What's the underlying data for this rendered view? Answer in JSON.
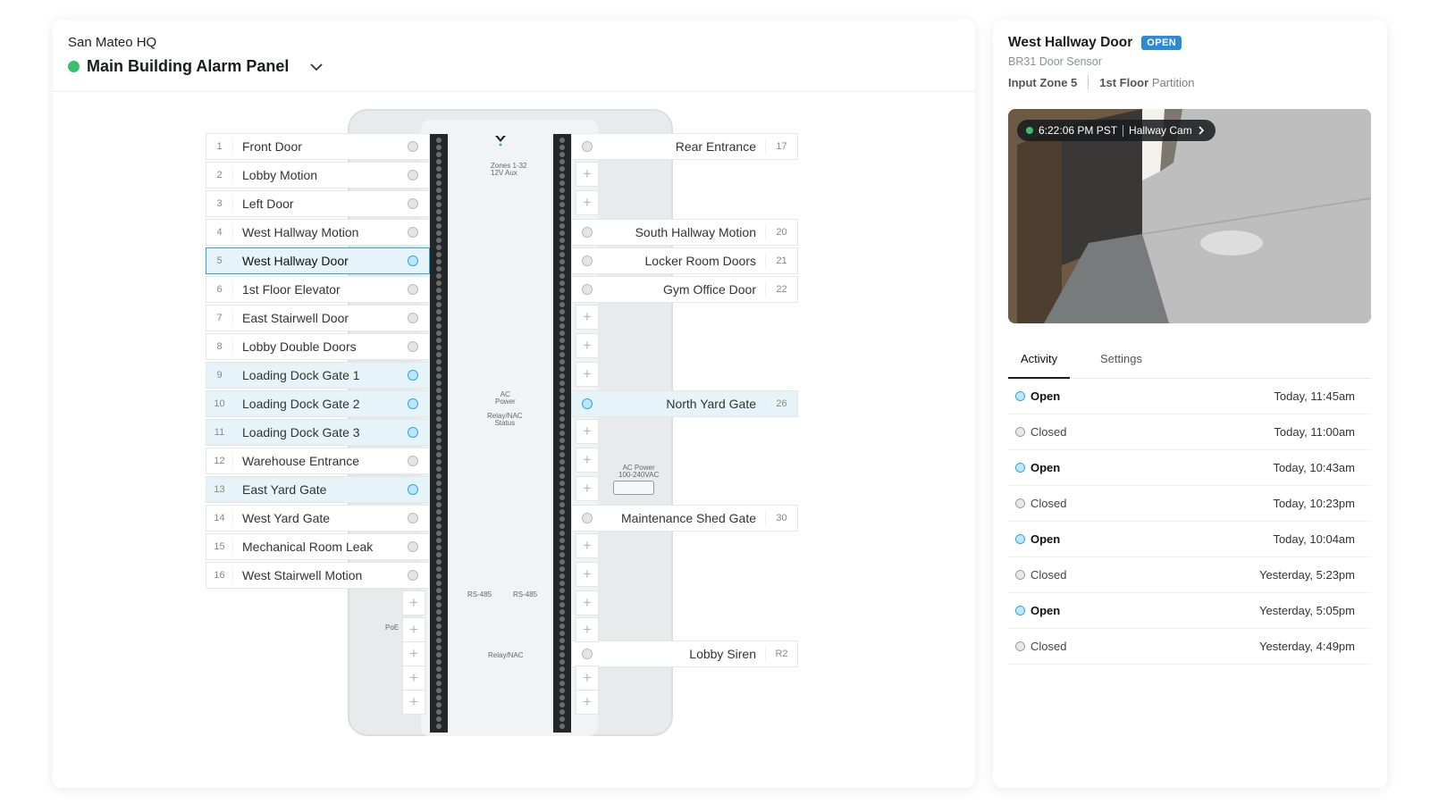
{
  "panel": {
    "site": "San Mateo HQ",
    "title": "Main Building Alarm Panel",
    "status_color": "#3cbf6c",
    "board": {
      "label_zones": "Zones 1-32\n12V Aux",
      "label_ac": "AC\nPower",
      "label_relay": "Relay/NAC\nStatus",
      "label_acpower": "AC Power\n100-240VAC",
      "label_rs485": "RS-485",
      "label_poe": "PoE",
      "label_relaynac": "Relay/NAC"
    },
    "left_zones": [
      {
        "num": "1",
        "name": "Front Door",
        "state": "off"
      },
      {
        "num": "2",
        "name": "Lobby Motion",
        "state": "off"
      },
      {
        "num": "3",
        "name": "Left Door",
        "state": "off"
      },
      {
        "num": "4",
        "name": "West Hallway Motion",
        "state": "off"
      },
      {
        "num": "5",
        "name": "West Hallway Door",
        "state": "selected"
      },
      {
        "num": "6",
        "name": "1st Floor Elevator",
        "state": "off"
      },
      {
        "num": "7",
        "name": "East Stairwell Door",
        "state": "off"
      },
      {
        "num": "8",
        "name": "Lobby Double Doors",
        "state": "off"
      },
      {
        "num": "9",
        "name": "Loading Dock Gate 1",
        "state": "on"
      },
      {
        "num": "10",
        "name": "Loading Dock Gate 2",
        "state": "on"
      },
      {
        "num": "11",
        "name": "Loading Dock Gate 3",
        "state": "on"
      },
      {
        "num": "12",
        "name": "Warehouse Entrance",
        "state": "off"
      },
      {
        "num": "13",
        "name": "East Yard Gate",
        "state": "on"
      },
      {
        "num": "14",
        "name": "West Yard Gate",
        "state": "off"
      },
      {
        "num": "15",
        "name": "Mechanical Room Leak",
        "state": "off"
      },
      {
        "num": "16",
        "name": "West Stairwell Motion",
        "state": "off"
      }
    ],
    "right_zones": [
      {
        "num": "17",
        "name": "Rear Entrance",
        "state": "off",
        "row": 0
      },
      {
        "num": "20",
        "name": "South Hallway Motion",
        "state": "off",
        "row": 3
      },
      {
        "num": "21",
        "name": "Locker Room Doors",
        "state": "off",
        "row": 4
      },
      {
        "num": "22",
        "name": "Gym Office Door",
        "state": "off",
        "row": 5
      },
      {
        "num": "26",
        "name": "North Yard Gate",
        "state": "on",
        "row": 9
      },
      {
        "num": "30",
        "name": "Maintenance Shed Gate",
        "state": "off",
        "row": 13
      },
      {
        "num": "R2",
        "name": "Lobby Siren",
        "state": "off",
        "row": 18
      }
    ],
    "add_symbol": "+"
  },
  "detail": {
    "title": "West Hallway Door",
    "status_badge": "OPEN",
    "badge_color": "#2c8bd6",
    "device": "BR31 Door Sensor",
    "zone": "Input Zone 5",
    "floor": "1st Floor",
    "partition": "Partition",
    "camera": {
      "time": "6:22:06 PM PST",
      "name": "Hallway Cam"
    },
    "tabs": [
      {
        "label": "Activity",
        "active": true
      },
      {
        "label": "Settings",
        "active": false
      }
    ],
    "activity": [
      {
        "status": "Open",
        "time": "Today, 11:45am"
      },
      {
        "status": "Closed",
        "time": "Today, 11:00am"
      },
      {
        "status": "Open",
        "time": "Today, 10:43am"
      },
      {
        "status": "Closed",
        "time": "Today, 10:23pm"
      },
      {
        "status": "Open",
        "time": "Today, 10:04am"
      },
      {
        "status": "Closed",
        "time": "Yesterday, 5:23pm"
      },
      {
        "status": "Open",
        "time": "Yesterday, 5:05pm"
      },
      {
        "status": "Closed",
        "time": "Yesterday, 4:49pm"
      }
    ]
  }
}
